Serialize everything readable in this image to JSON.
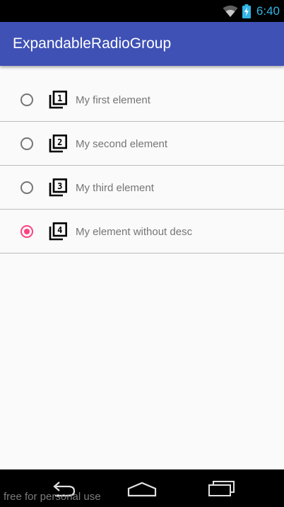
{
  "status_bar": {
    "time": "6:40",
    "icons": [
      "wifi-icon",
      "battery-charging-icon"
    ],
    "time_color": "#33b5e5"
  },
  "app_bar": {
    "title": "ExpandableRadioGroup",
    "color": "#3f51b5"
  },
  "radio_group": {
    "accent_color": "#ff4081",
    "items": [
      {
        "icon": "filter-1-icon",
        "number": "1",
        "label": "My first element",
        "checked": false
      },
      {
        "icon": "filter-2-icon",
        "number": "2",
        "label": "My second element",
        "checked": false
      },
      {
        "icon": "filter-3-icon",
        "number": "3",
        "label": "My third element",
        "checked": false
      },
      {
        "icon": "filter-4-icon",
        "number": "4",
        "label": "My element without desc",
        "checked": true
      }
    ]
  },
  "nav_bar": {
    "buttons": [
      "back-icon",
      "home-icon",
      "recents-icon"
    ]
  },
  "watermark": "free for personal use"
}
